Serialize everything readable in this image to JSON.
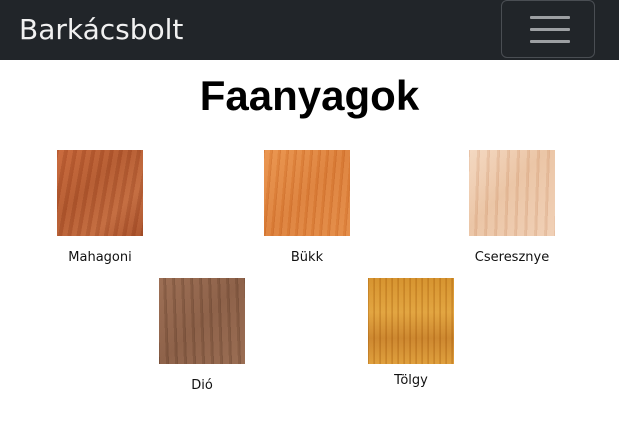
{
  "navbar": {
    "brand": "Barkácsbolt",
    "toggle_icon": "hamburger-menu-icon"
  },
  "page": {
    "title": "Faanyagok"
  },
  "woods": [
    {
      "name": "Mahagoni"
    },
    {
      "name": "Bükk"
    },
    {
      "name": "Cseresznye"
    },
    {
      "name": "Dió"
    },
    {
      "name": "Tölgy"
    }
  ],
  "colors": {
    "navbar_bg": "#212529",
    "brand_text": "#f1f1f1"
  }
}
